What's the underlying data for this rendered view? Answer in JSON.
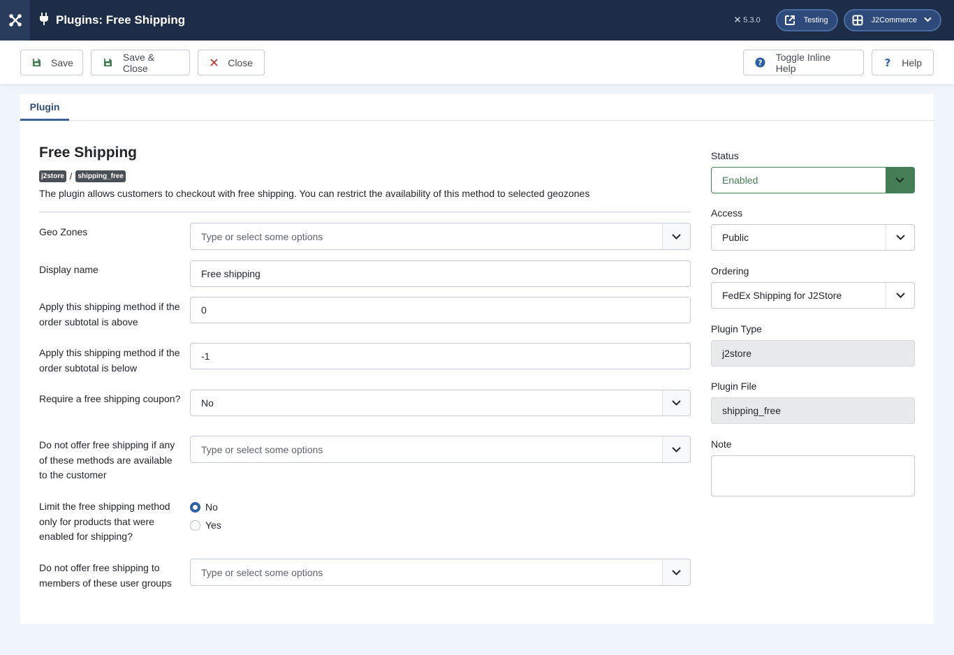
{
  "header": {
    "title": "Plugins: Free Shipping",
    "version": "5.3.0",
    "site_link_label": "Testing",
    "user_menu_label": "J2Commerce"
  },
  "toolbar": {
    "save_label": "Save",
    "save_close_label": "Save & Close",
    "close_label": "Close",
    "toggle_help_label": "Toggle Inline Help",
    "help_label": "Help"
  },
  "tabs": [
    {
      "label": "Plugin"
    }
  ],
  "plugin": {
    "title": "Free Shipping",
    "badge_group": "j2store",
    "badge_element": "shipping_free",
    "separator": "/",
    "description": "The plugin allows customers to checkout with free shipping. You can restrict the availability of this method to selected geozones"
  },
  "fields": {
    "geo_zones": {
      "label": "Geo Zones",
      "placeholder": "Type or select some options"
    },
    "display_name": {
      "label": "Display name",
      "value": "Free shipping"
    },
    "subtotal_above": {
      "label": "Apply this shipping method if the order subtotal is above",
      "value": "0"
    },
    "subtotal_below": {
      "label": "Apply this shipping method if the order subtotal is below",
      "value": "-1"
    },
    "require_coupon": {
      "label": "Require a free shipping coupon?",
      "value": "No"
    },
    "exclude_methods": {
      "label": "Do not offer free shipping if any of these methods are available to the customer",
      "placeholder": "Type or select some options"
    },
    "limit_products": {
      "label": "Limit the free shipping method only for products that were enabled for shipping?",
      "options": [
        "No",
        "Yes"
      ],
      "selected": "No"
    },
    "exclude_groups": {
      "label": "Do not offer free shipping to members of these user groups",
      "placeholder": "Type or select some options"
    }
  },
  "sidebar": {
    "status": {
      "label": "Status",
      "value": "Enabled"
    },
    "access": {
      "label": "Access",
      "value": "Public"
    },
    "ordering": {
      "label": "Ordering",
      "value": "FedEx Shipping for J2Store"
    },
    "plugin_type": {
      "label": "Plugin Type",
      "value": "j2store"
    },
    "plugin_file": {
      "label": "Plugin File",
      "value": "shipping_free"
    },
    "note": {
      "label": "Note",
      "value": ""
    }
  },
  "colors": {
    "header_bg": "#1e2d47",
    "status_green": "#457d54",
    "accent_blue": "#2b5fa6",
    "close_red": "#c0392b"
  }
}
